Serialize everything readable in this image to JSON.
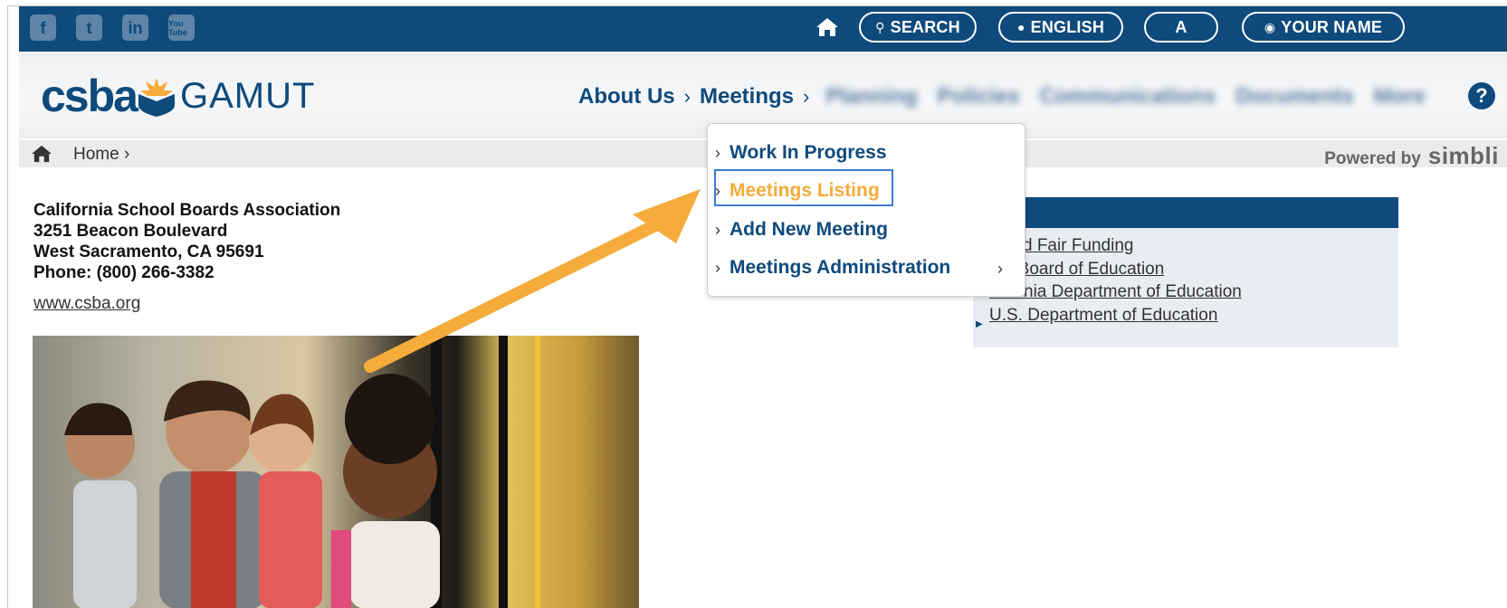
{
  "topbar": {
    "social": [
      {
        "name": "facebook-icon",
        "glyph": "f"
      },
      {
        "name": "twitter-icon",
        "glyph": "t"
      },
      {
        "name": "linkedin-icon",
        "glyph": "in"
      },
      {
        "name": "youtube-icon",
        "glyph": "You Tube"
      }
    ],
    "search_label": "SEARCH",
    "language_label": "ENGLISH",
    "font_size_label": "A",
    "user_label": "YOUR NAME"
  },
  "header": {
    "logo_csba": "csba",
    "logo_gamut": "GAMUT",
    "nav": {
      "about": "About Us",
      "meetings": "Meetings",
      "blurred_items": [
        "Planning",
        "Policies",
        "Communications",
        "Documents",
        "More"
      ]
    },
    "help": "?"
  },
  "breadcrumb": {
    "home": "Home",
    "powered_by": "Powered by",
    "brand": "simbli"
  },
  "address": {
    "org": "California School Boards Association",
    "street": "3251 Beacon Boulevard",
    "city": "West Sacramento, CA 95691",
    "phone": "Phone: (800) 266-3382",
    "website": "www.csba.org"
  },
  "dropdown": {
    "items": [
      {
        "label": "Work In Progress"
      },
      {
        "label": "Meetings Listing"
      },
      {
        "label": "Add New Meeting"
      },
      {
        "label": "Meetings Administration"
      }
    ]
  },
  "right_panel": {
    "links": [
      "...and Fair Funding",
      "...e Board of Education",
      "...fornia Department of Education",
      "U.S. Department of Education"
    ]
  },
  "colors": {
    "brand_blue": "#0e4a7c",
    "accent_orange": "#f5ac3b",
    "highlight_blue": "#3c7bd8"
  }
}
